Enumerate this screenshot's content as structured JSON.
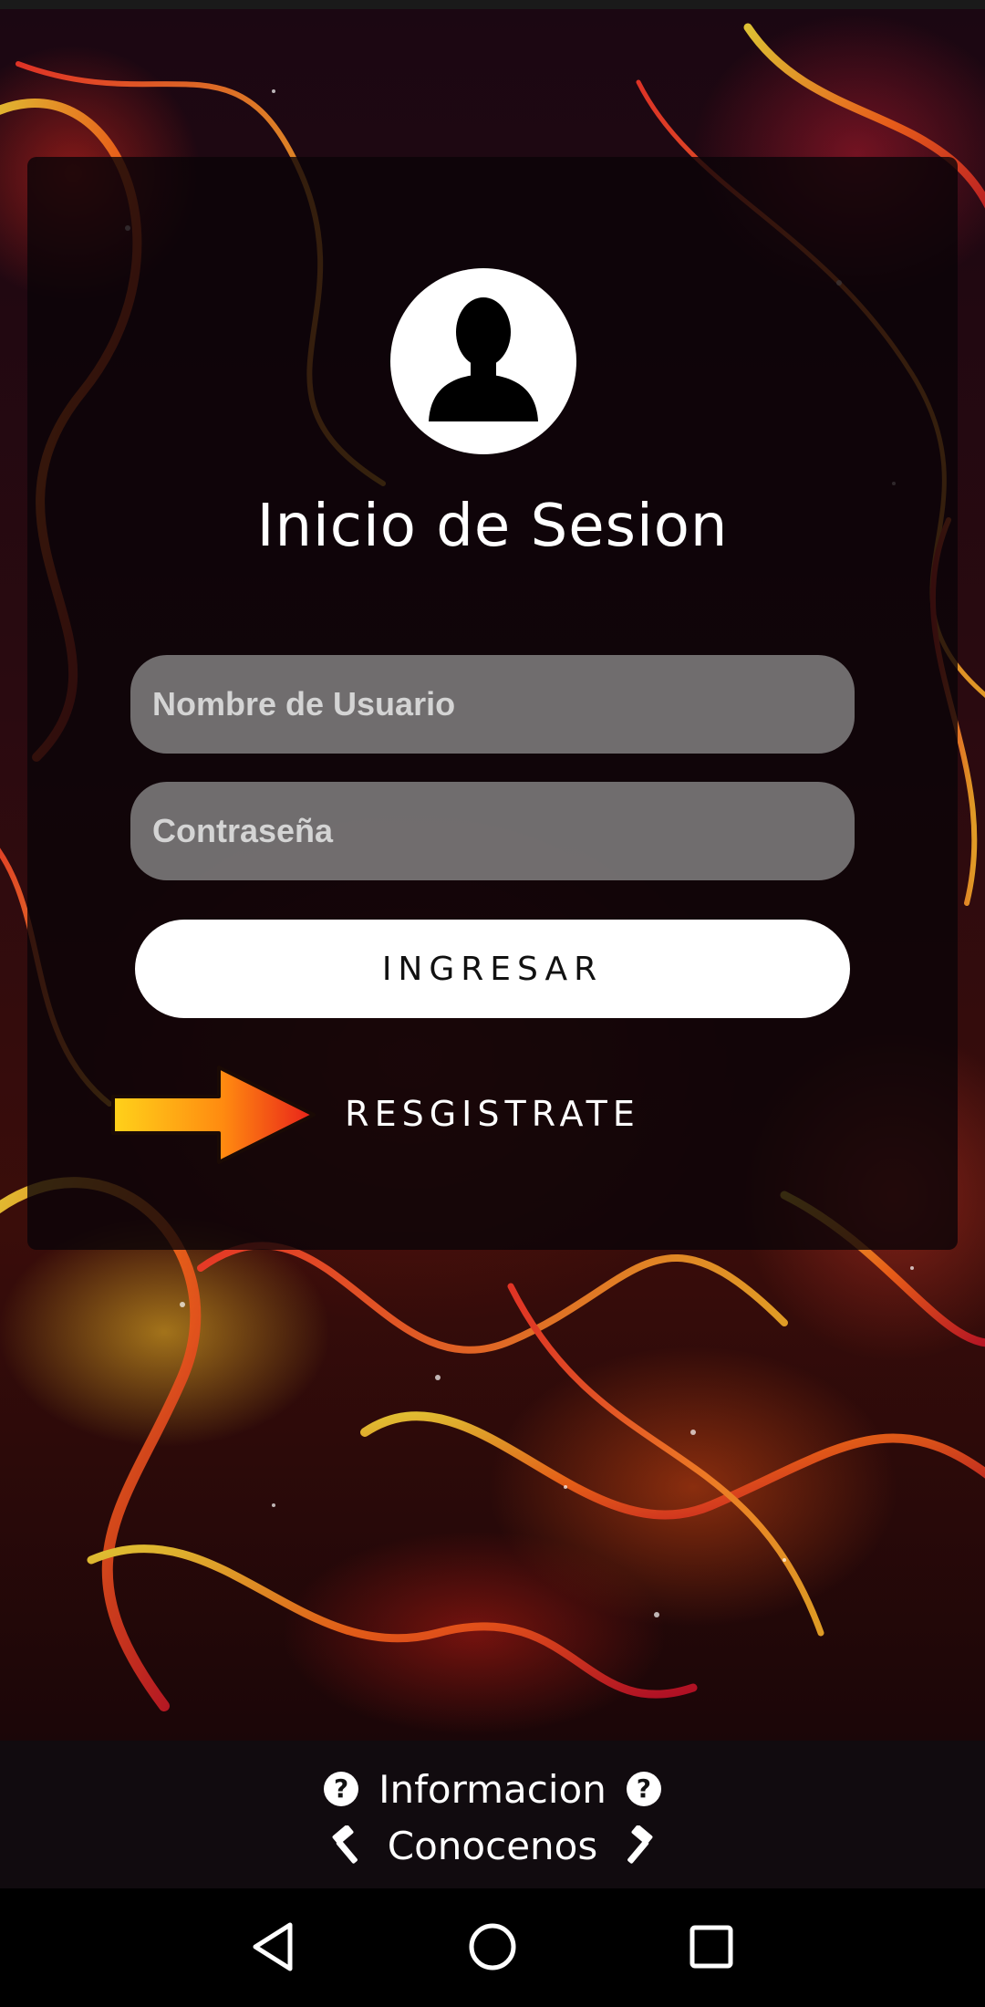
{
  "login": {
    "title": "Inicio de Sesion",
    "username_placeholder": "Nombre de Usuario",
    "password_placeholder": "Contraseña",
    "login_label": "INGRESAR",
    "register_label": "RESGISTRATE"
  },
  "footer": {
    "info_label": "Informacion",
    "about_label": "Conocenos"
  },
  "icons": {
    "avatar": "user-silhouette-icon",
    "arrow": "arrow-right-icon",
    "info": "question-circle-icon",
    "about": "hammer-icon",
    "nav_back": "triangle-back-icon",
    "nav_home": "circle-home-icon",
    "nav_recent": "square-recents-icon"
  },
  "colors": {
    "card_overlay": "#0a0408",
    "input_fill": "#969696",
    "button_fill": "#ffffff",
    "arrow_start": "#ffd21a",
    "arrow_end": "#e8201a"
  }
}
